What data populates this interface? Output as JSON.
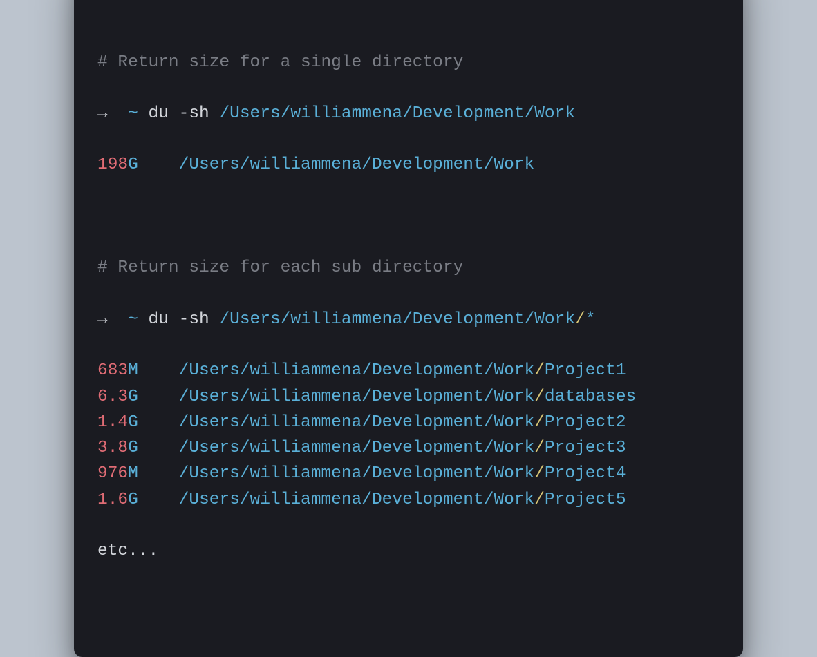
{
  "colors": {
    "bg_page": "#bcc4ce",
    "bg_terminal": "#1a1b21",
    "red": "#ed6a5e",
    "yellow": "#f5bf4f",
    "green": "#61c554",
    "comment": "#7a7d85",
    "path": "#5ab0d8",
    "num": "#e06c75",
    "slash_yellow": "#d6c474",
    "plain": "#d3d6db"
  },
  "comment1": "# Return size for a single directory",
  "prompt1": {
    "arrow": "→",
    "tilde": "~",
    "cmd": "du",
    "flag": "-sh",
    "path": "/Users/williammena/Development/Work"
  },
  "result1": {
    "num": "198",
    "unit": "G",
    "spacing": "    ",
    "path": "/Users/williammena/Development/Work"
  },
  "comment2": "# Return size for each sub directory",
  "prompt2": {
    "arrow": "→",
    "tilde": "~",
    "cmd": "du",
    "flag": "-sh",
    "path": "/Users/williammena/Development/Work",
    "slash": "/",
    "glob": "*"
  },
  "rows": [
    {
      "num": "683",
      "unit": "M",
      "spacing": "    ",
      "base": "/Users/williammena/Development/Work",
      "slash": "/",
      "dir": "Project1"
    },
    {
      "num": "6.3",
      "unit": "G",
      "spacing": "    ",
      "base": "/Users/williammena/Development/Work",
      "slash": "/",
      "dir": "databases"
    },
    {
      "num": "1.4",
      "unit": "G",
      "spacing": "    ",
      "base": "/Users/williammena/Development/Work",
      "slash": "/",
      "dir": "Project2"
    },
    {
      "num": "3.8",
      "unit": "G",
      "spacing": "    ",
      "base": "/Users/williammena/Development/Work",
      "slash": "/",
      "dir": "Project3"
    },
    {
      "num": "976",
      "unit": "M",
      "spacing": "    ",
      "base": "/Users/williammena/Development/Work",
      "slash": "/",
      "dir": "Project4"
    },
    {
      "num": "1.6",
      "unit": "G",
      "spacing": "    ",
      "base": "/Users/williammena/Development/Work",
      "slash": "/",
      "dir": "Project5"
    }
  ],
  "etc": "etc..."
}
